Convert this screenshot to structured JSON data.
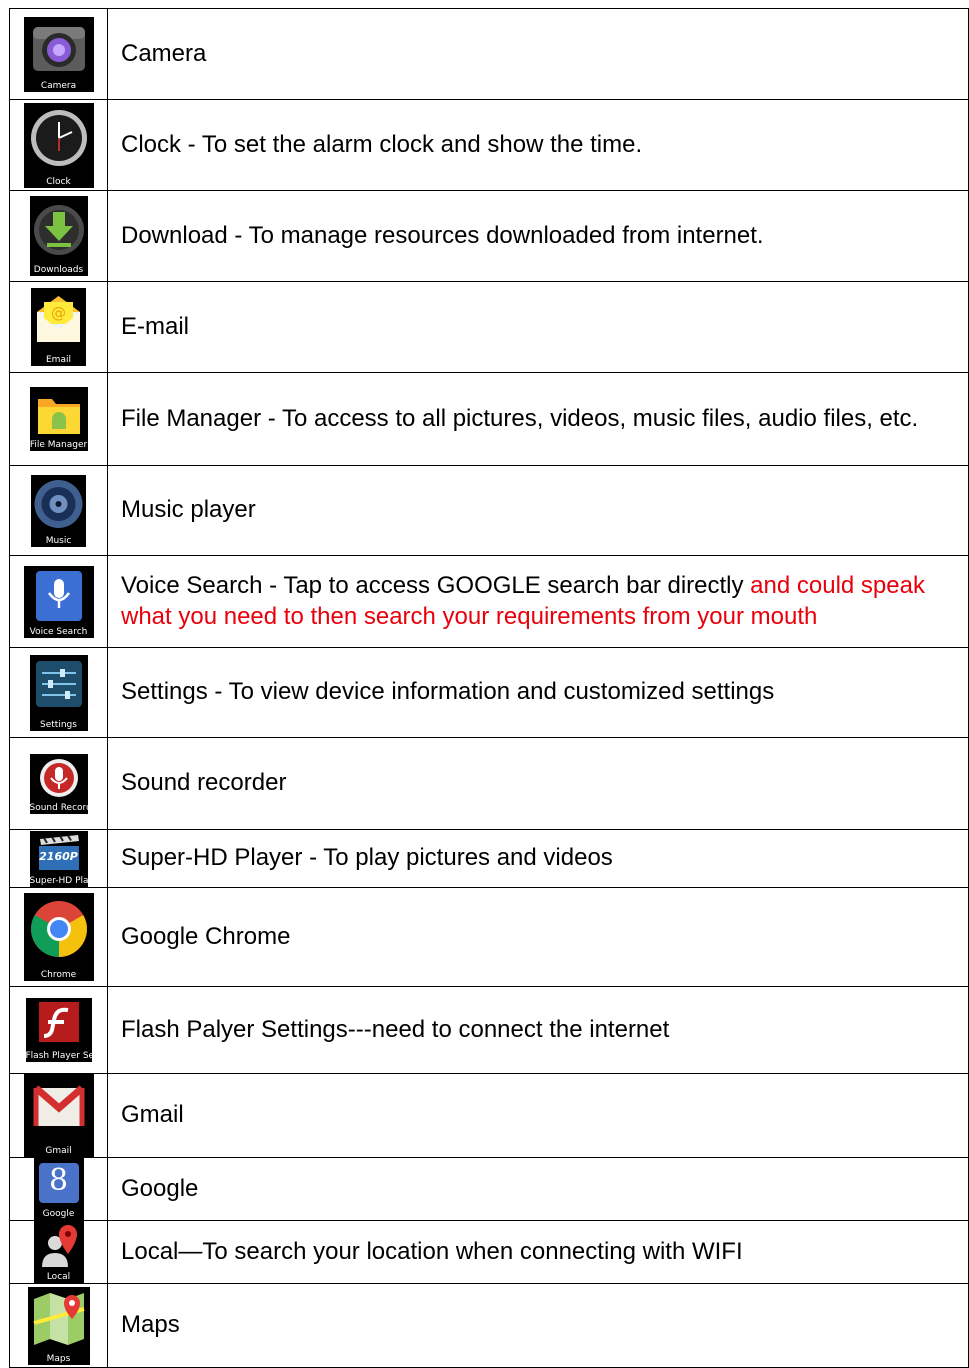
{
  "rows": [
    {
      "icon": "camera-icon",
      "icon_label": "Camera",
      "desc": "Camera"
    },
    {
      "icon": "clock-icon",
      "icon_label": "Clock",
      "desc": "Clock - To set the alarm clock and show the time."
    },
    {
      "icon": "download-icon",
      "icon_label": "Downloads",
      "desc": "Download - To manage resources downloaded from internet."
    },
    {
      "icon": "email-icon",
      "icon_label": "Email",
      "desc": "E-mail"
    },
    {
      "icon": "file-manager-icon",
      "icon_label": "File Manager",
      "desc": "File Manager - To access to all pictures, videos, music files, audio files, etc."
    },
    {
      "icon": "music-icon",
      "icon_label": "Music",
      "desc": "Music player"
    },
    {
      "icon": "voice-search-icon",
      "icon_label": "Voice Search",
      "desc": "Voice Search - Tap to access GOOGLE search bar directly ",
      "desc_red": "and could speak what you need to then search your requirements from your mouth"
    },
    {
      "icon": "settings-icon",
      "icon_label": "Settings",
      "desc": "Settings - To view device information and customized settings"
    },
    {
      "icon": "sound-recorder-icon",
      "icon_label": "Sound Recorde",
      "desc": "Sound recorder"
    },
    {
      "icon": "super-hd-player-icon",
      "icon_label": "Super-HD Play",
      "icon_badge": "2160P",
      "desc": "Super-HD Player - To play pictures and videos"
    },
    {
      "icon": "chrome-icon",
      "icon_label": "Chrome",
      "desc": "Google Chrome"
    },
    {
      "icon": "flash-player-icon",
      "icon_label": "Flash Player Se",
      "desc": "Flash Palyer Settings---need to connect the internet"
    },
    {
      "icon": "gmail-icon",
      "icon_label": "Gmail",
      "desc": "Gmail"
    },
    {
      "icon": "google-icon",
      "icon_label": "Google",
      "icon_badge": "8",
      "desc": "Google"
    },
    {
      "icon": "local-icon",
      "icon_label": "Local",
      "desc": "Local—To search your location when connecting with WIFI"
    },
    {
      "icon": "maps-icon",
      "icon_label": "Maps",
      "desc": "Maps"
    }
  ]
}
